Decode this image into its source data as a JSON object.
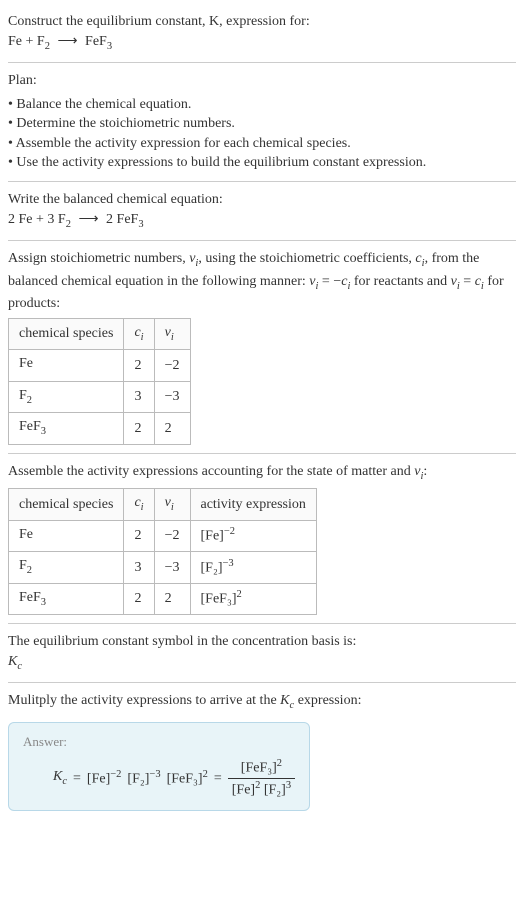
{
  "header": {
    "prompt": "Construct the equilibrium constant, K, expression for:",
    "reaction_lhs1": "Fe",
    "reaction_plus": "+",
    "reaction_lhs2": "F",
    "reaction_lhs2_sub": "2",
    "arrow": "⟶",
    "reaction_rhs": "FeF",
    "reaction_rhs_sub": "3"
  },
  "plan": {
    "title": "Plan:",
    "items": [
      "Balance the chemical equation.",
      "Determine the stoichiometric numbers.",
      "Assemble the activity expression for each chemical species.",
      "Use the activity expressions to build the equilibrium constant expression."
    ]
  },
  "balanced": {
    "title": "Write the balanced chemical equation:",
    "c1": "2",
    "sp1": "Fe",
    "plus1": "+",
    "c2": "3",
    "sp2": "F",
    "sp2_sub": "2",
    "arrow": "⟶",
    "c3": "2",
    "sp3": "FeF",
    "sp3_sub": "3"
  },
  "stoich": {
    "text_before": "Assign stoichiometric numbers, ",
    "nu": "ν",
    "nu_sub": "i",
    "text_mid1": ", using the stoichiometric coefficients, ",
    "c": "c",
    "c_sub": "i",
    "text_mid2": ", from the balanced chemical equation in the following manner: ",
    "eq1_lhs": "ν",
    "eq1_lhs_sub": "i",
    "eq1_mid": " = −",
    "eq1_rhs": "c",
    "eq1_rhs_sub": "i",
    "text_mid3": " for reactants and ",
    "eq2_lhs": "ν",
    "eq2_lhs_sub": "i",
    "eq2_mid": " = ",
    "eq2_rhs": "c",
    "eq2_rhs_sub": "i",
    "text_after": " for products:",
    "headers": {
      "species": "chemical species",
      "ci": "c",
      "ci_sub": "i",
      "nui": "ν",
      "nui_sub": "i"
    },
    "rows": [
      {
        "sp": "Fe",
        "sub": "",
        "ci": "2",
        "nui": "−2"
      },
      {
        "sp": "F",
        "sub": "2",
        "ci": "3",
        "nui": "−3"
      },
      {
        "sp": "FeF",
        "sub": "3",
        "ci": "2",
        "nui": "2"
      }
    ]
  },
  "activity": {
    "text": "Assemble the activity expressions accounting for the state of matter and ",
    "nu": "ν",
    "nu_sub": "i",
    "colon": ":",
    "headers": {
      "species": "chemical species",
      "ci": "c",
      "ci_sub": "i",
      "nui": "ν",
      "nui_sub": "i",
      "ae": "activity expression"
    },
    "rows": [
      {
        "sp": "Fe",
        "sub": "",
        "ci": "2",
        "nui": "−2",
        "ae_base": "[Fe]",
        "ae_sup": "−2"
      },
      {
        "sp": "F",
        "sub": "2",
        "ci": "3",
        "nui": "−3",
        "ae_base": "[F₂]",
        "ae_sup": "−3"
      },
      {
        "sp": "FeF",
        "sub": "3",
        "ci": "2",
        "nui": "2",
        "ae_base": "[FeF₃]",
        "ae_sup": "2"
      }
    ]
  },
  "symbol": {
    "text": "The equilibrium constant symbol in the concentration basis is:",
    "K": "K",
    "K_sub": "c"
  },
  "multiply": {
    "text_before": "Mulitply the activity expressions to arrive at the ",
    "K": "K",
    "K_sub": "c",
    "text_after": " expression:"
  },
  "answer": {
    "label": "Answer:",
    "K": "K",
    "K_sub": "c",
    "eq": " = ",
    "t1": "[Fe]",
    "t1_sup": "−2",
    "t2": "[F₂]",
    "t2_sup": "−3",
    "t3": "[FeF₃]",
    "t3_sup": "2",
    "eq2": " = ",
    "num": "[FeF₃]",
    "num_sup": "2",
    "den1": "[Fe]",
    "den1_sup": "2",
    "den2": "[F₂]",
    "den2_sup": "3"
  }
}
